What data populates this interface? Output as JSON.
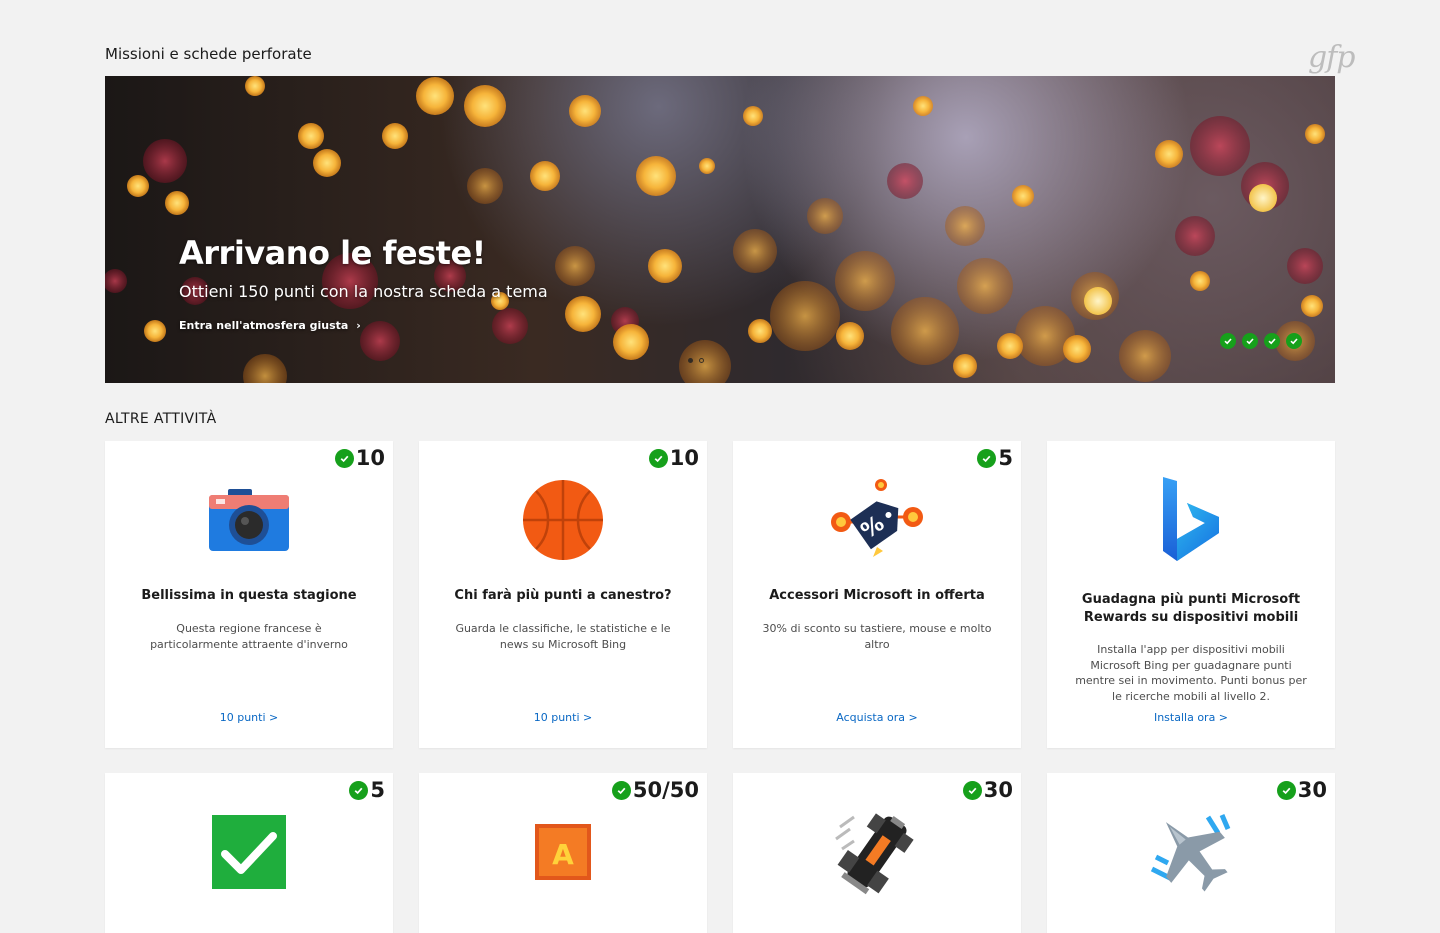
{
  "page": {
    "section_title": "Missioni e schede perforate",
    "watermark": "gfp",
    "other_title": "ALTRE ATTIVITÀ"
  },
  "hero": {
    "title": "Arrivano le feste!",
    "subtitle": "Ottieni 150 punti con la nostra scheda a tema",
    "link": "Entra nell'atmosfera giusta",
    "completed_checks": 4,
    "carousel_pages": 2,
    "carousel_current": 1
  },
  "cards": [
    {
      "points": "10",
      "icon": "camera-icon",
      "title": "Bellissima in questa stagione",
      "desc": "Questa regione francese è particolarmente attraente d'inverno",
      "link": "10 punti >"
    },
    {
      "points": "10",
      "icon": "basketball-icon",
      "title": "Chi farà più punti a canestro?",
      "desc": "Guarda le classifiche, le statistiche e le news su Microsoft Bing",
      "link": "10 punti >"
    },
    {
      "points": "5",
      "icon": "discount-tag-icon",
      "title": "Accessori Microsoft in offerta",
      "desc": "30% di sconto su tastiere, mouse e molto altro",
      "link": "Acquista ora >"
    },
    {
      "points": "",
      "icon": "bing-logo-icon",
      "title": "Guadagna più punti Microsoft Rewards su dispositivi mobili",
      "desc": "Installa l'app per dispositivi mobili Microsoft Bing per guadagnare punti mentre sei in movimento. Punti bonus per le ricerche mobili al livello 2.",
      "link": "Installa ora >"
    },
    {
      "points": "5",
      "icon": "green-checkmark-icon",
      "title": "",
      "desc": "",
      "link": ""
    },
    {
      "points": "50/50",
      "icon": "letter-block-icon",
      "title": "",
      "desc": "",
      "link": ""
    },
    {
      "points": "30",
      "icon": "race-car-icon",
      "title": "",
      "desc": "",
      "link": ""
    },
    {
      "points": "30",
      "icon": "jet-plane-icon",
      "title": "",
      "desc": "",
      "link": ""
    }
  ],
  "colors": {
    "accent_link": "#0a68c4",
    "check_green": "#16a01b",
    "background": "#f2f2f2"
  }
}
